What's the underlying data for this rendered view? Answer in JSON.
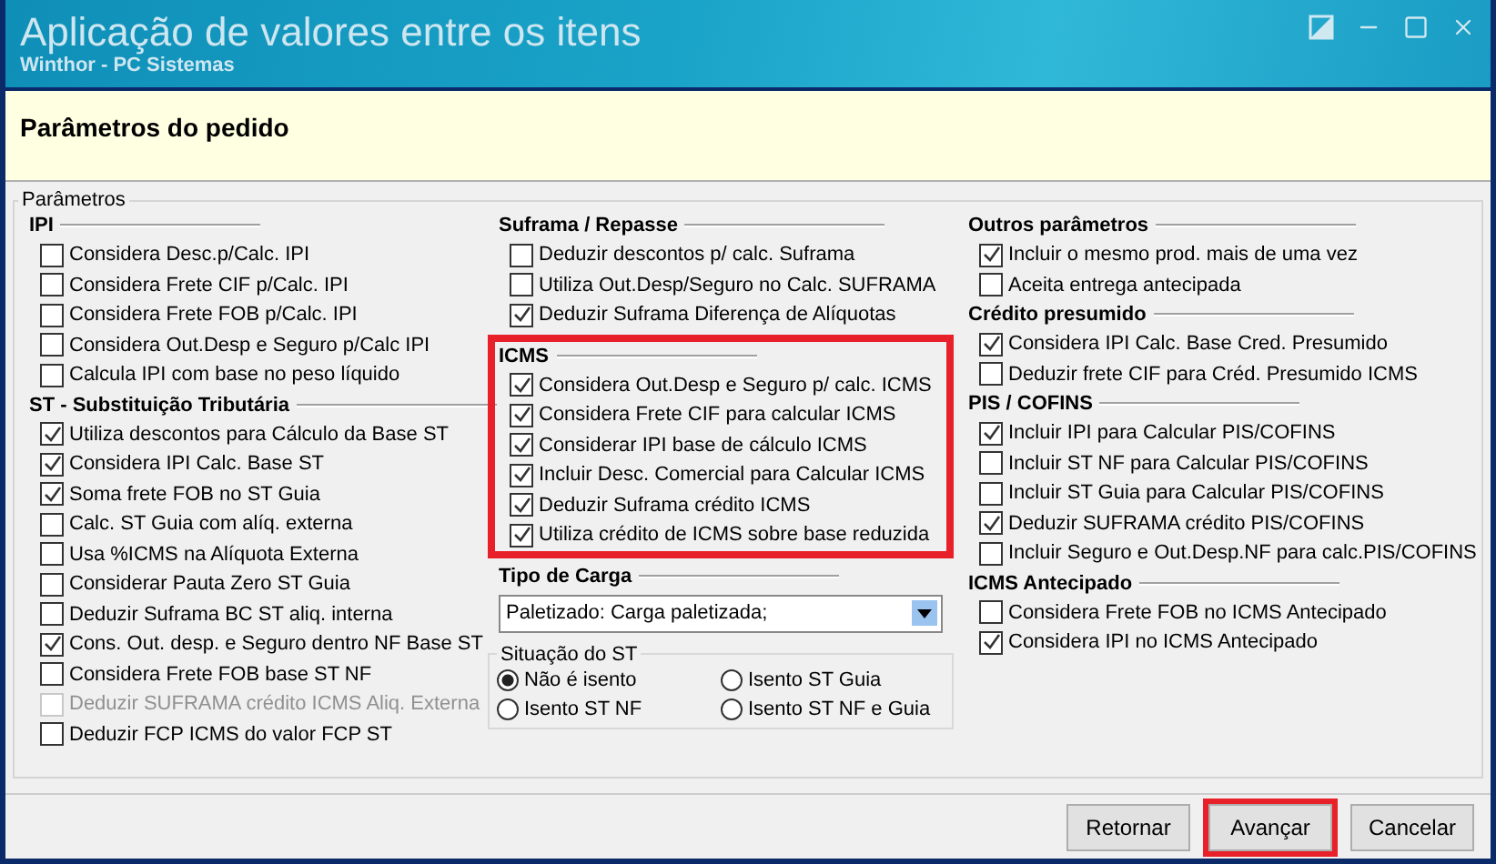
{
  "window": {
    "title": "Aplicação de valores entre os itens",
    "subtitle": "Winthor - PC Sistemas"
  },
  "header": {
    "title": "Parâmetros do pedido"
  },
  "group": {
    "title": "Parâmetros"
  },
  "columns": [
    {
      "sections": [
        {
          "kind": "checks",
          "title": "IPI",
          "items": [
            {
              "label": "Considera Desc.p/Calc. IPI",
              "checked": false,
              "disabled": false
            },
            {
              "label": "Considera Frete CIF p/Calc. IPI",
              "checked": false,
              "disabled": false
            },
            {
              "label": "Considera Frete FOB p/Calc. IPI",
              "checked": false,
              "disabled": false
            },
            {
              "label": "Considera Out.Desp e Seguro p/Calc IPI",
              "checked": false,
              "disabled": false
            },
            {
              "label": "Calcula IPI com base no peso líquido",
              "checked": false,
              "disabled": false
            }
          ]
        },
        {
          "kind": "checks",
          "title": "ST - Substituição Tributária",
          "items": [
            {
              "label": "Utiliza descontos para Cálculo da Base ST",
              "checked": true,
              "disabled": false
            },
            {
              "label": "Considera IPI Calc. Base ST",
              "checked": true,
              "disabled": false
            },
            {
              "label": "Soma frete FOB no ST Guia",
              "checked": true,
              "disabled": false
            },
            {
              "label": "Calc. ST Guia com alíq. externa",
              "checked": false,
              "disabled": false
            },
            {
              "label": "Usa %ICMS na Alíquota Externa",
              "checked": false,
              "disabled": false
            },
            {
              "label": "Considerar Pauta Zero ST Guia",
              "checked": false,
              "disabled": false
            },
            {
              "label": "Deduzir Suframa BC ST aliq. interna",
              "checked": false,
              "disabled": false
            },
            {
              "label": "Cons. Out. desp. e Seguro dentro NF Base ST",
              "checked": true,
              "disabled": false
            },
            {
              "label": "Considera Frete FOB base ST NF",
              "checked": false,
              "disabled": false
            },
            {
              "label": "Deduzir SUFRAMA crédito ICMS Aliq. Externa",
              "checked": false,
              "disabled": true
            },
            {
              "label": "Deduzir FCP ICMS do valor FCP ST",
              "checked": false,
              "disabled": false
            }
          ]
        }
      ]
    },
    {
      "sections": [
        {
          "kind": "checks",
          "title": "Suframa / Repasse",
          "items": [
            {
              "label": "Deduzir descontos p/ calc. Suframa",
              "checked": false,
              "disabled": false
            },
            {
              "label": "Utiliza Out.Desp/Seguro no Calc. SUFRAMA",
              "checked": false,
              "disabled": false
            },
            {
              "label": "Deduzir Suframa Diferença de Alíquotas",
              "checked": true,
              "disabled": false
            }
          ]
        },
        {
          "kind": "checks",
          "title": "ICMS",
          "highlighted": true,
          "items": [
            {
              "label": "Considera Out.Desp e Seguro p/ calc. ICMS",
              "checked": true,
              "disabled": false
            },
            {
              "label": "Considera Frete CIF para calcular ICMS",
              "checked": true,
              "disabled": false
            },
            {
              "label": "Considerar IPI base de cálculo ICMS",
              "checked": true,
              "disabled": false
            },
            {
              "label": "Incluir Desc. Comercial  para Calcular ICMS",
              "checked": true,
              "disabled": false
            },
            {
              "label": "Deduzir Suframa crédito ICMS",
              "checked": true,
              "disabled": false
            },
            {
              "label": "Utiliza crédito de ICMS sobre base reduzida",
              "checked": true,
              "disabled": false
            }
          ]
        },
        {
          "kind": "dropdown",
          "title": "Tipo de Carga",
          "value": "Paletizado: Carga paletizada;"
        },
        {
          "kind": "radios",
          "title": "Situação do ST",
          "options": [
            {
              "label": "Não é isento",
              "selected": true
            },
            {
              "label": "Isento ST Guia",
              "selected": false
            },
            {
              "label": "Isento ST NF",
              "selected": false
            },
            {
              "label": "Isento ST NF e Guia",
              "selected": false
            }
          ]
        }
      ]
    },
    {
      "sections": [
        {
          "kind": "checks",
          "title": "Outros parâmetros",
          "items": [
            {
              "label": "Incluir o mesmo prod. mais de uma vez",
              "checked": true,
              "disabled": false
            },
            {
              "label": "Aceita entrega antecipada",
              "checked": false,
              "disabled": false
            }
          ]
        },
        {
          "kind": "checks",
          "title": "Crédito presumido",
          "items": [
            {
              "label": "Considera IPI Calc. Base Cred. Presumido",
              "checked": true,
              "disabled": false
            },
            {
              "label": "Deduzir frete CIF para Créd. Presumido ICMS",
              "checked": false,
              "disabled": false
            }
          ]
        },
        {
          "kind": "checks",
          "title": "PIS / COFINS",
          "items": [
            {
              "label": "Incluir IPI para Calcular PIS/COFINS",
              "checked": true,
              "disabled": false
            },
            {
              "label": "Incluir ST NF para Calcular PIS/COFINS",
              "checked": false,
              "disabled": false
            },
            {
              "label": "Incluir ST Guia para Calcular PIS/COFINS",
              "checked": false,
              "disabled": false
            },
            {
              "label": "Deduzir SUFRAMA crédito PIS/COFINS",
              "checked": true,
              "disabled": false
            },
            {
              "label": "Incluir Seguro e Out.Desp.NF para calc.PIS/COFINS",
              "checked": false,
              "disabled": false
            }
          ]
        },
        {
          "kind": "checks",
          "title": "ICMS Antecipado",
          "items": [
            {
              "label": "Considera Frete FOB no ICMS Antecipado",
              "checked": false,
              "disabled": false
            },
            {
              "label": "Considera IPI no ICMS Antecipado",
              "checked": true,
              "disabled": false
            }
          ]
        }
      ]
    }
  ],
  "buttons": [
    {
      "label": "Retornar",
      "highlighted": false
    },
    {
      "label": "Avançar",
      "highlighted": true
    },
    {
      "label": "Cancelar",
      "highlighted": false
    }
  ]
}
